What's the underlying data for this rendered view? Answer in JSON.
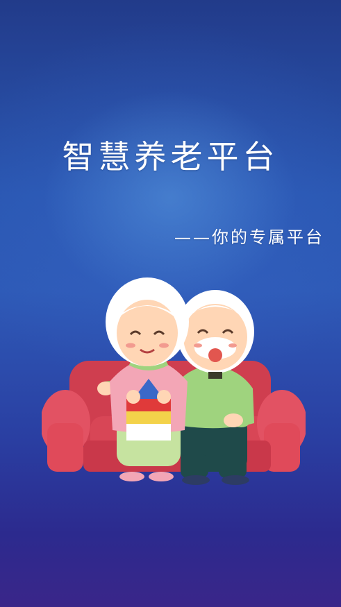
{
  "splash": {
    "title": "智慧养老平台",
    "subtitle": "——你的专属平台"
  },
  "illustration": {
    "subject": "elderly-couple-on-sofa",
    "colors": {
      "sofa": "#e04a5a",
      "grandma_sweater": "#f3a6b6",
      "grandpa_sweater": "#9fd37e",
      "grandpa_pants": "#1f4a4a",
      "hair": "#ffffff",
      "skin": "#ffd6b5"
    }
  },
  "colors": {
    "background_top": "#223b8a",
    "background_mid": "#2e5ab7",
    "background_bottom": "#3a2689",
    "text": "#ffffff"
  }
}
